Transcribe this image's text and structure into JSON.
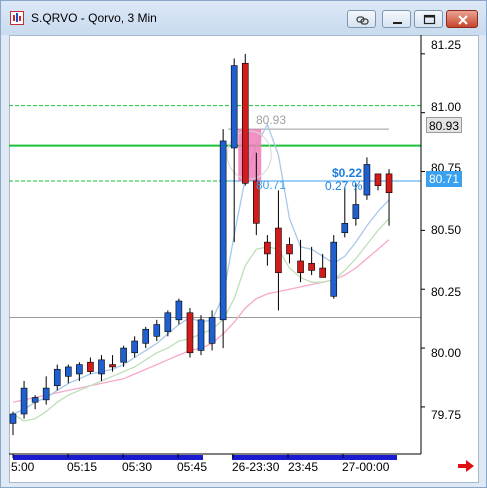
{
  "window": {
    "title": "S.QRVO - Qorvo, 3 Min",
    "icons": [
      "app-chart-icon",
      "link-icon",
      "minimize-icon",
      "restore-icon",
      "close-icon"
    ]
  },
  "axis": {
    "price_ticks": [
      "81.25",
      "81.00",
      "80.75",
      "80.50",
      "80.25",
      "80.00",
      "79.75"
    ],
    "time_ticks": [
      "5:00",
      "05:15",
      "05:30",
      "05:45",
      "26-23:30",
      "23:45",
      "27-00:00"
    ],
    "current_price_badge": "80.71",
    "reference_price_badge": "80.93"
  },
  "annotations": {
    "upper_ref": "80.93",
    "lower_ref": "80.71",
    "change_amount": "$0.22",
    "change_percent": "0.27 %"
  },
  "colors": {
    "up_candle": "#1f5fd0",
    "down_candle": "#d21b1b",
    "green_level": "#19c23a",
    "cyan_level": "#3aa0f0",
    "highlight": "#ee7fb8",
    "fast_ma": "#a8c8ea",
    "mid_ma": "#bde0b8",
    "slow_ma": "#f7a8c8",
    "timeline_bar": "#1a1ad0"
  },
  "chart_data": {
    "type": "candlestick",
    "ylim": [
      79.55,
      81.33
    ],
    "candles": [
      {
        "o": 79.68,
        "h": 79.73,
        "l": 79.63,
        "c": 79.72
      },
      {
        "o": 79.72,
        "h": 79.86,
        "l": 79.7,
        "c": 79.83
      },
      {
        "o": 79.77,
        "h": 79.8,
        "l": 79.74,
        "c": 79.79
      },
      {
        "o": 79.78,
        "h": 79.88,
        "l": 79.76,
        "c": 79.83
      },
      {
        "o": 79.84,
        "h": 79.93,
        "l": 79.82,
        "c": 79.91
      },
      {
        "o": 79.88,
        "h": 79.93,
        "l": 79.85,
        "c": 79.92
      },
      {
        "o": 79.89,
        "h": 79.94,
        "l": 79.86,
        "c": 79.93
      },
      {
        "o": 79.94,
        "h": 79.96,
        "l": 79.89,
        "c": 79.9
      },
      {
        "o": 79.89,
        "h": 79.97,
        "l": 79.86,
        "c": 79.95
      },
      {
        "o": 79.93,
        "h": 79.97,
        "l": 79.9,
        "c": 79.92
      },
      {
        "o": 79.94,
        "h": 80.01,
        "l": 79.92,
        "c": 80.0
      },
      {
        "o": 79.98,
        "h": 80.05,
        "l": 79.96,
        "c": 80.03
      },
      {
        "o": 80.02,
        "h": 80.09,
        "l": 80.0,
        "c": 80.08
      },
      {
        "o": 80.05,
        "h": 80.12,
        "l": 80.03,
        "c": 80.1
      },
      {
        "o": 80.07,
        "h": 80.16,
        "l": 80.05,
        "c": 80.15
      },
      {
        "o": 80.12,
        "h": 80.21,
        "l": 80.1,
        "c": 80.2
      },
      {
        "o": 80.15,
        "h": 80.17,
        "l": 79.96,
        "c": 79.98
      },
      {
        "o": 79.99,
        "h": 80.14,
        "l": 79.97,
        "c": 80.12
      },
      {
        "o": 80.02,
        "h": 80.16,
        "l": 79.99,
        "c": 80.13
      },
      {
        "o": 80.12,
        "h": 80.93,
        "l": 80.0,
        "c": 80.88
      },
      {
        "o": 80.85,
        "h": 81.23,
        "l": 80.45,
        "c": 81.2
      },
      {
        "o": 81.21,
        "h": 81.25,
        "l": 80.69,
        "c": 80.7
      },
      {
        "o": 80.71,
        "h": 80.83,
        "l": 80.48,
        "c": 80.53
      },
      {
        "o": 80.45,
        "h": 80.48,
        "l": 80.35,
        "c": 80.4
      },
      {
        "o": 80.51,
        "h": 80.67,
        "l": 80.16,
        "c": 80.32
      },
      {
        "o": 80.44,
        "h": 80.47,
        "l": 80.36,
        "c": 80.4
      },
      {
        "o": 80.37,
        "h": 80.46,
        "l": 80.28,
        "c": 80.32
      },
      {
        "o": 80.36,
        "h": 80.43,
        "l": 80.31,
        "c": 80.33
      },
      {
        "o": 80.34,
        "h": 80.4,
        "l": 80.3,
        "c": 80.3
      },
      {
        "o": 80.22,
        "h": 80.48,
        "l": 80.21,
        "c": 80.45
      },
      {
        "o": 80.49,
        "h": 80.68,
        "l": 80.47,
        "c": 80.53
      },
      {
        "o": 80.55,
        "h": 80.7,
        "l": 80.52,
        "c": 80.61
      },
      {
        "o": 80.65,
        "h": 80.81,
        "l": 80.63,
        "c": 80.78
      },
      {
        "o": 80.74,
        "h": 80.74,
        "l": 80.67,
        "c": 80.69
      },
      {
        "o": 80.74,
        "h": 80.76,
        "l": 80.52,
        "c": 80.66
      }
    ],
    "levels": [
      {
        "price": 81.03,
        "style": "dashed",
        "color": "green"
      },
      {
        "price": 80.86,
        "style": "solid",
        "color": "green"
      },
      {
        "price": 80.71,
        "style": "dashed",
        "color": "green"
      },
      {
        "price": 80.71,
        "style": "solid",
        "color": "cyan"
      },
      {
        "price": 80.93,
        "style": "solid",
        "color": "gray"
      },
      {
        "price": 80.13,
        "style": "solid",
        "color": "gray"
      }
    ],
    "ma_fast": [
      79.72,
      79.74,
      79.77,
      79.79,
      79.82,
      79.85,
      79.87,
      79.89,
      79.9,
      79.91,
      79.93,
      79.96,
      79.99,
      80.02,
      80.06,
      80.1,
      80.13,
      80.11,
      80.12,
      80.22,
      80.48,
      80.72,
      80.86,
      80.95,
      80.82,
      80.55,
      80.43,
      80.42,
      80.39,
      80.36,
      80.39,
      80.45,
      80.52,
      80.58,
      80.63
    ],
    "ma_mid": [
      79.72,
      79.69,
      79.7,
      79.73,
      79.77,
      79.8,
      79.82,
      79.84,
      79.86,
      79.88,
      79.9,
      79.92,
      79.95,
      79.98,
      80.0,
      80.03,
      80.04,
      80.06,
      80.08,
      80.12,
      80.21,
      80.35,
      80.42,
      80.43,
      80.42,
      80.34,
      80.3,
      80.28,
      80.28,
      80.29,
      80.33,
      80.38,
      80.44,
      80.5,
      80.55
    ],
    "ma_slow": [
      79.77,
      79.78,
      79.79,
      79.8,
      79.81,
      79.82,
      79.83,
      79.84,
      79.85,
      79.86,
      79.87,
      79.89,
      79.91,
      79.93,
      79.95,
      79.97,
      79.99,
      80.0,
      80.02,
      80.06,
      80.11,
      80.17,
      80.21,
      80.23,
      80.24,
      80.25,
      80.26,
      80.27,
      80.28,
      80.29,
      80.31,
      80.34,
      80.38,
      80.42,
      80.46
    ]
  }
}
